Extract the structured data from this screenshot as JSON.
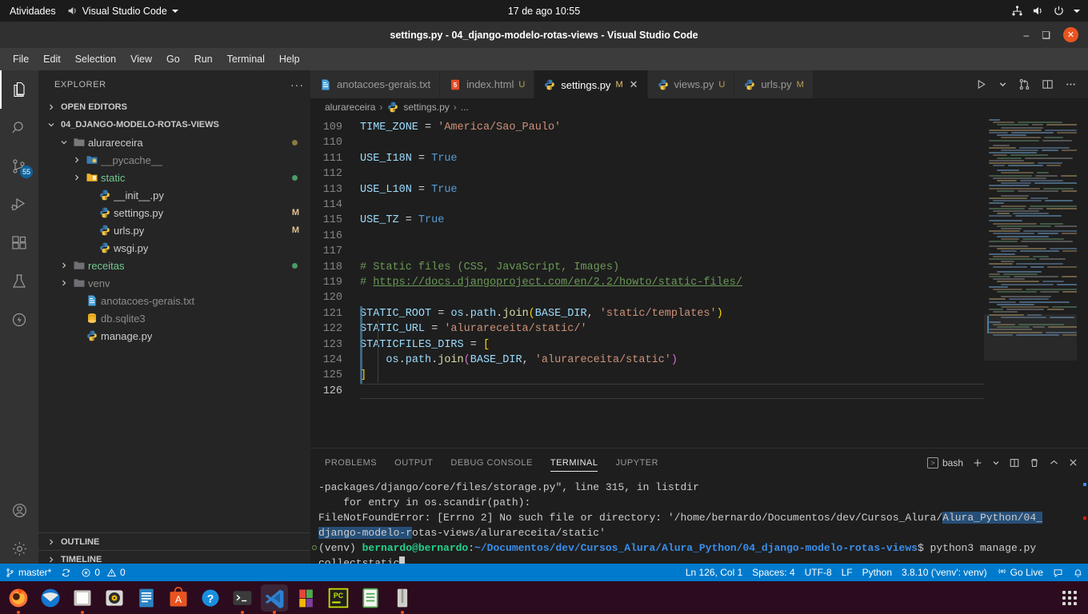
{
  "gnome": {
    "activities": "Atividades",
    "app_name": "Visual Studio Code",
    "clock": "17 de ago  10:55",
    "tray_icons": [
      "network-icon",
      "volume-icon",
      "power-icon",
      "chevron-down-icon"
    ]
  },
  "window": {
    "title": "settings.py - 04_django-modelo-rotas-views - Visual Studio Code",
    "minimize": "–",
    "maximize": "❑",
    "close": "✕"
  },
  "menubar": [
    "File",
    "Edit",
    "Selection",
    "View",
    "Go",
    "Run",
    "Terminal",
    "Help"
  ],
  "activitybar": {
    "items": [
      {
        "name": "explorer",
        "icon": "files-icon",
        "active": true,
        "badge": null
      },
      {
        "name": "search",
        "icon": "search-icon",
        "active": false,
        "badge": null
      },
      {
        "name": "source-control",
        "icon": "source-control-icon",
        "active": false,
        "badge": "55"
      },
      {
        "name": "run-and-debug",
        "icon": "run-debug-icon",
        "active": false,
        "badge": null
      },
      {
        "name": "extensions",
        "icon": "extensions-icon",
        "active": false,
        "badge": null
      },
      {
        "name": "testing",
        "icon": "beaker-icon",
        "active": false,
        "badge": null
      },
      {
        "name": "live-share",
        "icon": "lightning-icon",
        "active": false,
        "badge": null
      }
    ],
    "bottom": [
      {
        "name": "accounts",
        "icon": "account-icon"
      },
      {
        "name": "manage",
        "icon": "gear-icon"
      }
    ]
  },
  "sidebar": {
    "title": "EXPLORER",
    "more_actions": "···",
    "open_editors_label": "OPEN EDITORS",
    "project_label": "04_DJANGO-MODELO-ROTAS-VIEWS",
    "tree": [
      {
        "label": "alurareceira",
        "icon": "folder-open-icon",
        "indent": 1,
        "expanded": true,
        "mark": "",
        "dot": "#8a7b3f"
      },
      {
        "label": "__pycache__",
        "icon": "folder-python-icon",
        "indent": 2,
        "expanded": false,
        "mark": "",
        "dim": true
      },
      {
        "label": "static",
        "icon": "folder-static-icon",
        "indent": 2,
        "expanded": false,
        "mark": "",
        "dot": "#4d9a68",
        "green": true
      },
      {
        "label": "__init__.py",
        "icon": "python-icon",
        "indent": 3,
        "mark": ""
      },
      {
        "label": "settings.py",
        "icon": "python-icon",
        "indent": 3,
        "mark": "M"
      },
      {
        "label": "urls.py",
        "icon": "python-icon",
        "indent": 3,
        "mark": "M"
      },
      {
        "label": "wsgi.py",
        "icon": "python-icon",
        "indent": 3,
        "mark": ""
      },
      {
        "label": "receitas",
        "icon": "folder-icon",
        "indent": 1,
        "expanded": false,
        "mark": "",
        "dot": "#4d9a68",
        "green": true
      },
      {
        "label": "venv",
        "icon": "folder-icon",
        "indent": 1,
        "expanded": false,
        "mark": "",
        "dim": true
      },
      {
        "label": "anotacoes-gerais.txt",
        "icon": "text-file-icon",
        "indent": 2,
        "mark": "",
        "dim": true
      },
      {
        "label": "db.sqlite3",
        "icon": "database-icon",
        "indent": 2,
        "mark": "",
        "dim": true
      },
      {
        "label": "manage.py",
        "icon": "python-icon",
        "indent": 2,
        "mark": ""
      }
    ],
    "outline_label": "OUTLINE",
    "timeline_label": "TIMELINE"
  },
  "tabs": [
    {
      "label": "anotacoes-gerais.txt",
      "icon": "text-file-icon",
      "status": "",
      "active": false,
      "closable": false
    },
    {
      "label": "index.html",
      "icon": "html-icon",
      "status": "U",
      "active": false,
      "closable": false
    },
    {
      "label": "settings.py",
      "icon": "python-icon",
      "status": "M",
      "active": true,
      "closable": true
    },
    {
      "label": "views.py",
      "icon": "python-icon",
      "status": "U",
      "active": false,
      "closable": false
    },
    {
      "label": "urls.py",
      "icon": "python-icon",
      "status": "M",
      "active": false,
      "closable": false
    }
  ],
  "editor_actions": [
    "run-icon",
    "chevron-down-icon",
    "split-compare-icon",
    "split-editor-icon",
    "more-actions-icon"
  ],
  "breadcrumbs": [
    "alurareceira",
    "settings.py",
    "..."
  ],
  "code": {
    "first_line_number": 109,
    "lines": [
      {
        "n": 109,
        "tokens": [
          {
            "t": "TIME_ZONE",
            "c": "t-var"
          },
          {
            "t": " = ",
            "c": "t-op"
          },
          {
            "t": "'America/Sao_Paulo'",
            "c": "t-str"
          }
        ]
      },
      {
        "n": 110,
        "tokens": []
      },
      {
        "n": 111,
        "tokens": [
          {
            "t": "USE_I18N",
            "c": "t-var"
          },
          {
            "t": " = ",
            "c": "t-op"
          },
          {
            "t": "True",
            "c": "t-kw"
          }
        ]
      },
      {
        "n": 112,
        "tokens": []
      },
      {
        "n": 113,
        "tokens": [
          {
            "t": "USE_L10N",
            "c": "t-var"
          },
          {
            "t": " = ",
            "c": "t-op"
          },
          {
            "t": "True",
            "c": "t-kw"
          }
        ]
      },
      {
        "n": 114,
        "tokens": []
      },
      {
        "n": 115,
        "tokens": [
          {
            "t": "USE_TZ",
            "c": "t-var"
          },
          {
            "t": " = ",
            "c": "t-op"
          },
          {
            "t": "True",
            "c": "t-kw"
          }
        ]
      },
      {
        "n": 116,
        "tokens": []
      },
      {
        "n": 117,
        "tokens": []
      },
      {
        "n": 118,
        "tokens": [
          {
            "t": "# Static files (CSS, JavaScript, Images)",
            "c": "t-com"
          }
        ]
      },
      {
        "n": 119,
        "tokens": [
          {
            "t": "# ",
            "c": "t-com"
          },
          {
            "t": "https://docs.djangoproject.com/en/2.2/howto/static-files/",
            "c": "t-lnk"
          }
        ]
      },
      {
        "n": 120,
        "tokens": []
      },
      {
        "n": 121,
        "tokens": [
          {
            "t": "STATIC_ROOT",
            "c": "t-var"
          },
          {
            "t": " = ",
            "c": "t-op"
          },
          {
            "t": "os",
            "c": "t-var"
          },
          {
            "t": ".",
            "c": "t-op"
          },
          {
            "t": "path",
            "c": "t-var"
          },
          {
            "t": ".",
            "c": "t-op"
          },
          {
            "t": "join",
            "c": "t-fn"
          },
          {
            "t": "(",
            "c": "t-brk"
          },
          {
            "t": "BASE_DIR",
            "c": "t-var"
          },
          {
            "t": ", ",
            "c": "t-op"
          },
          {
            "t": "'static/templates'",
            "c": "t-str"
          },
          {
            "t": ")",
            "c": "t-brk"
          }
        ]
      },
      {
        "n": 122,
        "tokens": [
          {
            "t": "STATIC_URL",
            "c": "t-var"
          },
          {
            "t": " = ",
            "c": "t-op"
          },
          {
            "t": "'alurareceita/static/'",
            "c": "t-str"
          }
        ]
      },
      {
        "n": 123,
        "tokens": [
          {
            "t": "STATICFILES_DIRS",
            "c": "t-var"
          },
          {
            "t": " = ",
            "c": "t-op"
          },
          {
            "t": "[",
            "c": "t-brk"
          }
        ]
      },
      {
        "n": 124,
        "tokens": [
          {
            "t": "    ",
            "c": "t-op"
          },
          {
            "t": "os",
            "c": "t-var"
          },
          {
            "t": ".",
            "c": "t-op"
          },
          {
            "t": "path",
            "c": "t-var"
          },
          {
            "t": ".",
            "c": "t-op"
          },
          {
            "t": "join",
            "c": "t-fn"
          },
          {
            "t": "(",
            "c": "t-brk2"
          },
          {
            "t": "BASE_DIR",
            "c": "t-var"
          },
          {
            "t": ", ",
            "c": "t-op"
          },
          {
            "t": "'alurareceita/static'",
            "c": "t-str"
          },
          {
            "t": ")",
            "c": "t-brk2"
          }
        ]
      },
      {
        "n": 125,
        "tokens": [
          {
            "t": "]",
            "c": "t-brk"
          }
        ]
      },
      {
        "n": 126,
        "tokens": []
      }
    ]
  },
  "panel": {
    "tabs": [
      "PROBLEMS",
      "OUTPUT",
      "DEBUG CONSOLE",
      "TERMINAL",
      "JUPYTER"
    ],
    "active_tab": "TERMINAL",
    "terminal_name": "bash",
    "actions": [
      "new-terminal-icon",
      "chevron-down-icon",
      "split-terminal-icon",
      "kill-terminal-icon",
      "maximize-panel-icon",
      "close-panel-icon"
    ],
    "terminal_lines": [
      {
        "segments": [
          {
            "t": "-packages/django/core/files/storage.py\", line 315, in listdir"
          }
        ]
      },
      {
        "segments": [
          {
            "t": "    for entry in os.scandir(path):"
          }
        ]
      },
      {
        "segments": [
          {
            "t": "FileNotFoundError: [Errno 2] No such file or directory: '/home/bernardo/Documentos/dev/Cursos_Alura/"
          },
          {
            "t": "Alura_Python/04_",
            "c": "sel"
          }
        ]
      },
      {
        "segments": [
          {
            "t": "django-modelo-r",
            "c": "sel"
          },
          {
            "t": "otas-views/alurareceita/static'"
          }
        ]
      },
      {
        "prompt": true,
        "segments": [
          {
            "t": "(venv) "
          },
          {
            "t": "bernardo@bernardo",
            "c": "tgreen2"
          },
          {
            "t": ":",
            "c": ""
          },
          {
            "t": "~/Documentos/dev/Cursos_Alura/Alura_Python/04_django-modelo-rotas-views",
            "c": "tblue"
          },
          {
            "t": "$ python3 manage.py"
          }
        ]
      },
      {
        "segments": [
          {
            "t": "collectstatic"
          },
          {
            "caret": true
          }
        ]
      }
    ]
  },
  "statusbar": {
    "left": [
      {
        "name": "remote-branch",
        "icon": "git-branch-icon",
        "text": "master*"
      },
      {
        "name": "sync-changes",
        "icon": "sync-icon",
        "text": ""
      },
      {
        "name": "problems",
        "icon": "error-warning-icon",
        "text": "0  0"
      }
    ],
    "branch": "master*",
    "errors": "0",
    "warnings": "0",
    "right": [
      {
        "name": "editor-position",
        "text": "Ln 126, Col 1"
      },
      {
        "name": "indentation",
        "text": "Spaces: 4"
      },
      {
        "name": "encoding",
        "text": "UTF-8"
      },
      {
        "name": "eol",
        "text": "LF"
      },
      {
        "name": "language-mode",
        "text": "Python"
      },
      {
        "name": "python-interpreter",
        "text": "3.8.10 ('venv': venv)"
      },
      {
        "name": "go-live",
        "text": "Go Live"
      }
    ],
    "right_icons": [
      "feedback-icon",
      "notifications-bell-icon"
    ]
  },
  "taskbar": {
    "items": [
      {
        "name": "firefox",
        "running": true
      },
      {
        "name": "thunderbird",
        "running": false
      },
      {
        "name": "files",
        "running": true
      },
      {
        "name": "rhythmbox",
        "running": false
      },
      {
        "name": "libreoffice-writer",
        "running": false
      },
      {
        "name": "ubuntu-software",
        "running": false
      },
      {
        "name": "help",
        "running": false
      },
      {
        "name": "terminal",
        "running": true
      },
      {
        "name": "visual-studio-code",
        "running": true,
        "active": true
      },
      {
        "name": "microsoft-office",
        "running": false
      },
      {
        "name": "pycharm",
        "running": false
      },
      {
        "name": "libreoffice-calc",
        "running": false
      },
      {
        "name": "archive-manager",
        "running": true
      }
    ],
    "show_apps": "show-applications-icon"
  }
}
